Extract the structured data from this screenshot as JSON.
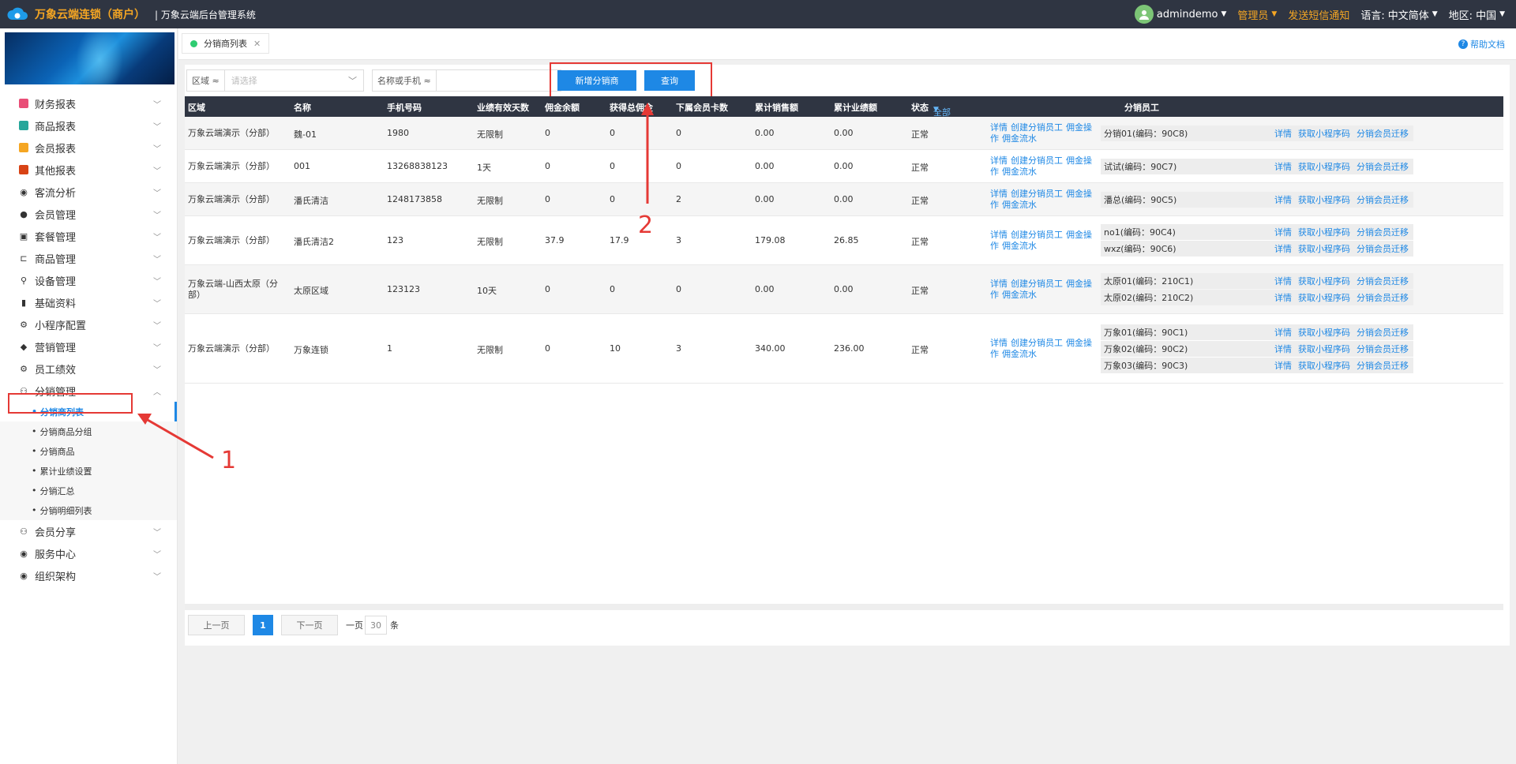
{
  "header": {
    "brand": "万象云端连锁（商户）",
    "system_name": "| 万象云端后台管理系统",
    "user": "admindemo",
    "role": "管理员",
    "sms": "发送短信通知",
    "lang_label": "语言:",
    "lang_value": "中文简体",
    "region_label": "地区:",
    "region_value": "中国"
  },
  "sidebar": {
    "items": [
      {
        "label": "财务报表",
        "icon": "finance-icon"
      },
      {
        "label": "商品报表",
        "icon": "goods-report-icon"
      },
      {
        "label": "会员报表",
        "icon": "member-report-icon"
      },
      {
        "label": "其他报表",
        "icon": "other-report-icon"
      },
      {
        "label": "客流分析",
        "icon": "traffic-icon"
      },
      {
        "label": "会员管理",
        "icon": "member-icon"
      },
      {
        "label": "套餐管理",
        "icon": "package-icon"
      },
      {
        "label": "商品管理",
        "icon": "goods-icon"
      },
      {
        "label": "设备管理",
        "icon": "device-icon"
      },
      {
        "label": "基础资料",
        "icon": "basic-icon"
      },
      {
        "label": "小程序配置",
        "icon": "gear-icon"
      },
      {
        "label": "营销管理",
        "icon": "tag-icon"
      },
      {
        "label": "员工绩效",
        "icon": "gear-icon"
      },
      {
        "label": "分销管理",
        "icon": "distribution-icon"
      }
    ],
    "sub_items": [
      "分销商列表",
      "分销商品分组",
      "分销商品",
      "累计业绩设置",
      "分销汇总",
      "分销明细列表"
    ],
    "items_after": [
      {
        "label": "会员分享",
        "icon": "share-icon"
      },
      {
        "label": "服务中心",
        "icon": "service-icon"
      },
      {
        "label": "组织架构",
        "icon": "org-icon"
      }
    ]
  },
  "tabs": {
    "active": "分销商列表",
    "help": "帮助文档"
  },
  "filters": {
    "region_label": "区域 ≈",
    "region_placeholder": "请选择",
    "name_label": "名称或手机 ≈",
    "add_button": "新增分销商",
    "query_button": "查询"
  },
  "table": {
    "headers": [
      "区域",
      "名称",
      "手机号码",
      "业绩有效天数",
      "佣金余额",
      "获得总佣金",
      "下属会员卡数",
      "累计销售额",
      "累计业绩额",
      "状态",
      "全部",
      "分销员工"
    ],
    "ops": [
      "详情",
      "创建分销员工",
      "佣金操作",
      "佣金流水"
    ],
    "staff_links": [
      "详情",
      "获取小程序码",
      "分销会员迁移"
    ],
    "rows": [
      {
        "region": "万象云端演示（分部）",
        "name": "魏-01",
        "phone": "1980",
        "days": "无限制",
        "balance": "0",
        "total": "0",
        "cards": "0",
        "sales": "0.00",
        "perf": "0.00",
        "status": "正常",
        "staff": [
          "分销01(编码：90C8)"
        ]
      },
      {
        "region": "万象云端演示（分部）",
        "name": "001",
        "phone": "13268838123",
        "days": "1天",
        "balance": "0",
        "total": "0",
        "cards": "0",
        "sales": "0.00",
        "perf": "0.00",
        "status": "正常",
        "staff": [
          "试试(编码：90C7)"
        ]
      },
      {
        "region": "万象云端演示（分部）",
        "name": "潘氏清洁",
        "phone": "1248173858",
        "days": "无限制",
        "balance": "0",
        "total": "0",
        "cards": "2",
        "sales": "0.00",
        "perf": "0.00",
        "status": "正常",
        "staff": [
          "潘总(编码：90C5)"
        ]
      },
      {
        "region": "万象云端演示（分部）",
        "name": "潘氏清洁2",
        "phone": "123",
        "days": "无限制",
        "balance": "37.9",
        "total": "17.9",
        "cards": "3",
        "sales": "179.08",
        "perf": "26.85",
        "status": "正常",
        "staff": [
          "no1(编码：90C4)",
          "wxz(编码：90C6)"
        ]
      },
      {
        "region": "万象云端-山西太原（分部）",
        "name": "太原区域",
        "phone": "123123",
        "days": "10天",
        "balance": "0",
        "total": "0",
        "cards": "0",
        "sales": "0.00",
        "perf": "0.00",
        "status": "正常",
        "staff": [
          "太原01(编码：210C1)",
          "太原02(编码：210C2)"
        ]
      },
      {
        "region": "万象云端演示（分部）",
        "name": "万象连锁",
        "phone": "1",
        "days": "无限制",
        "balance": "0",
        "total": "10",
        "cards": "3",
        "sales": "340.00",
        "perf": "236.00",
        "status": "正常",
        "staff": [
          "万象01(编码：90C1)",
          "万象02(编码：90C2)",
          "万象03(编码：90C3)"
        ]
      }
    ]
  },
  "pager": {
    "prev": "上一页",
    "current": "1",
    "next": "下一页",
    "per_label": "一页",
    "per_value": "30",
    "unit": "条"
  },
  "annotations": {
    "one": "1",
    "two": "2"
  },
  "colors": {
    "accent": "#1e88e5",
    "annotation": "#e53935",
    "brand": "#f5a623"
  }
}
